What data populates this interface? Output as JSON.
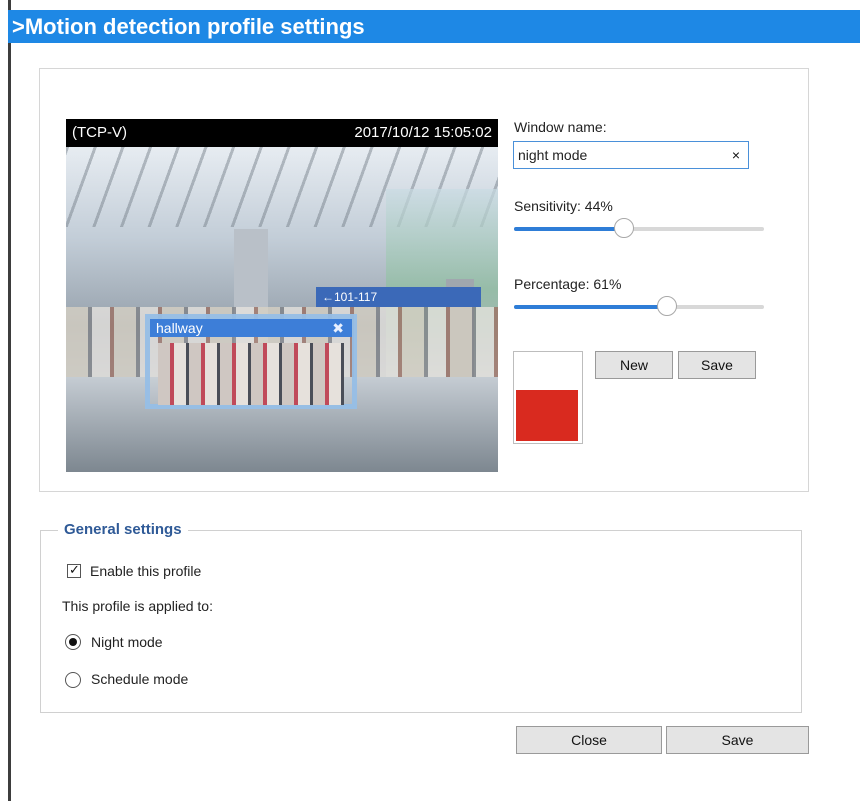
{
  "page": {
    "title": ">Motion detection profile settings"
  },
  "preview": {
    "camera_label": "(TCP-V)",
    "timestamp": "2017/10/12 15:05:02",
    "sign_text": "←101-117",
    "window": {
      "name": "hallway",
      "close_icon": "move-icon"
    }
  },
  "settings": {
    "window_name_label": "Window name:",
    "window_name_value": "night mode",
    "clear_icon": "×",
    "sensitivity_label": "Sensitivity: 44%",
    "sensitivity_value": 44,
    "percentage_label": "Percentage: 61%",
    "percentage_value": 61,
    "buttons": {
      "new_label": "New",
      "save_label": "Save"
    },
    "swatch_color": "#d92a1f"
  },
  "general": {
    "legend": "General settings",
    "enable_label": "Enable this profile",
    "enable_checked": true,
    "applied_label": "This profile is applied to:",
    "options": [
      {
        "label": "Night mode",
        "selected": true
      },
      {
        "label": "Schedule mode",
        "selected": false
      }
    ]
  },
  "footer": {
    "close_label": "Close",
    "save_label": "Save"
  },
  "colors": {
    "title_bar": "#1e88e5",
    "accent": "#2e7dd7",
    "legend_text": "#2f5a97"
  }
}
